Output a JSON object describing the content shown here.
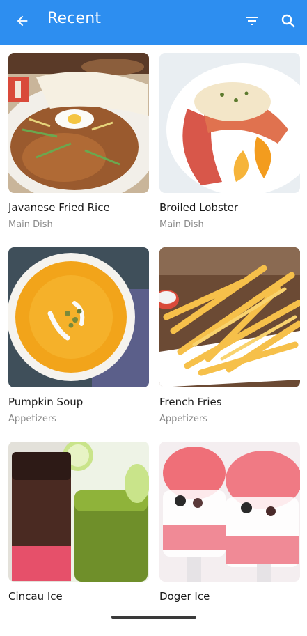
{
  "appbar": {
    "title": "Recent",
    "background": "#2d8ef0",
    "back_icon": "arrow-left-icon",
    "filter_icon": "filter-icon",
    "search_icon": "search-icon"
  },
  "items": [
    {
      "name": "Javanese Fried Rice",
      "category": "Main Dish",
      "image": "fried-rice-image"
    },
    {
      "name": "Broiled Lobster",
      "category": "Main Dish",
      "image": "lobster-image"
    },
    {
      "name": "Pumpkin Soup",
      "category": "Appetizers",
      "image": "pumpkin-soup-image"
    },
    {
      "name": "French Fries",
      "category": "Appetizers",
      "image": "french-fries-image"
    },
    {
      "name": "Cincau Ice",
      "category": "",
      "image": "cincau-ice-image"
    },
    {
      "name": "Doger Ice",
      "category": "",
      "image": "doger-ice-image"
    }
  ]
}
